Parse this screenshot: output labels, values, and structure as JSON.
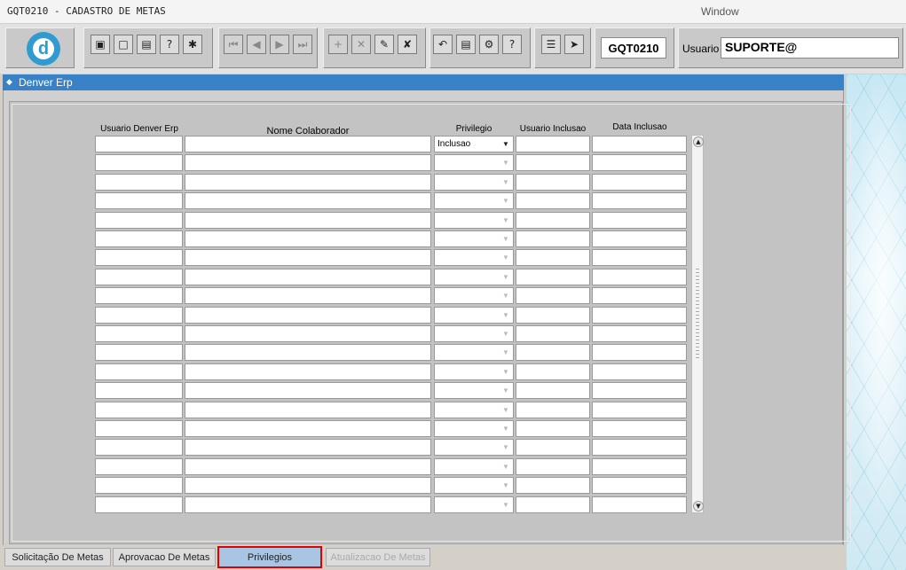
{
  "menubar": {
    "title": "GQT0210 - CADASTRO DE METAS",
    "window_menu": "Window"
  },
  "toolbar": {
    "logo_letter": "d",
    "groups": [
      {
        "name": "document",
        "buttons": [
          "save-icon",
          "window-icon",
          "print-icon",
          "query-help-icon",
          "execute-query-icon"
        ]
      },
      {
        "name": "navigation",
        "buttons": [
          "first-record-icon",
          "previous-record-icon",
          "next-record-icon",
          "last-record-icon"
        ]
      },
      {
        "name": "records",
        "buttons": [
          "insert-record-icon",
          "delete-record-icon",
          "edit-record-icon",
          "clear-record-icon"
        ]
      },
      {
        "name": "actions",
        "buttons": [
          "undo-icon",
          "clipboard-icon",
          "tools-icon",
          "help-icon"
        ]
      },
      {
        "name": "menu-exit",
        "buttons": [
          "menu-icon",
          "exit-icon"
        ]
      }
    ],
    "form_code": "GQT0210",
    "usuario_label": "Usuario",
    "usuario_value": "SUPORTE@"
  },
  "window": {
    "title": "Denver Erp"
  },
  "grid": {
    "headers": {
      "usuario": "Usuario Denver Erp",
      "nome": "Nome Colaborador",
      "privilegio": "Privilegio",
      "usuario_inclusao": "Usuario Inclusao",
      "data_inclusao": "Data Inclusao"
    },
    "first_row_privilegio": "Inclusao",
    "row_count": 20
  },
  "tabs": [
    {
      "label": "Solicitação De Metas",
      "state": "normal"
    },
    {
      "label": "Aprovacao De Metas",
      "state": "normal"
    },
    {
      "label": "Privilegios",
      "state": "active"
    },
    {
      "label": "Atualizacao De Metas",
      "state": "disabled"
    }
  ]
}
